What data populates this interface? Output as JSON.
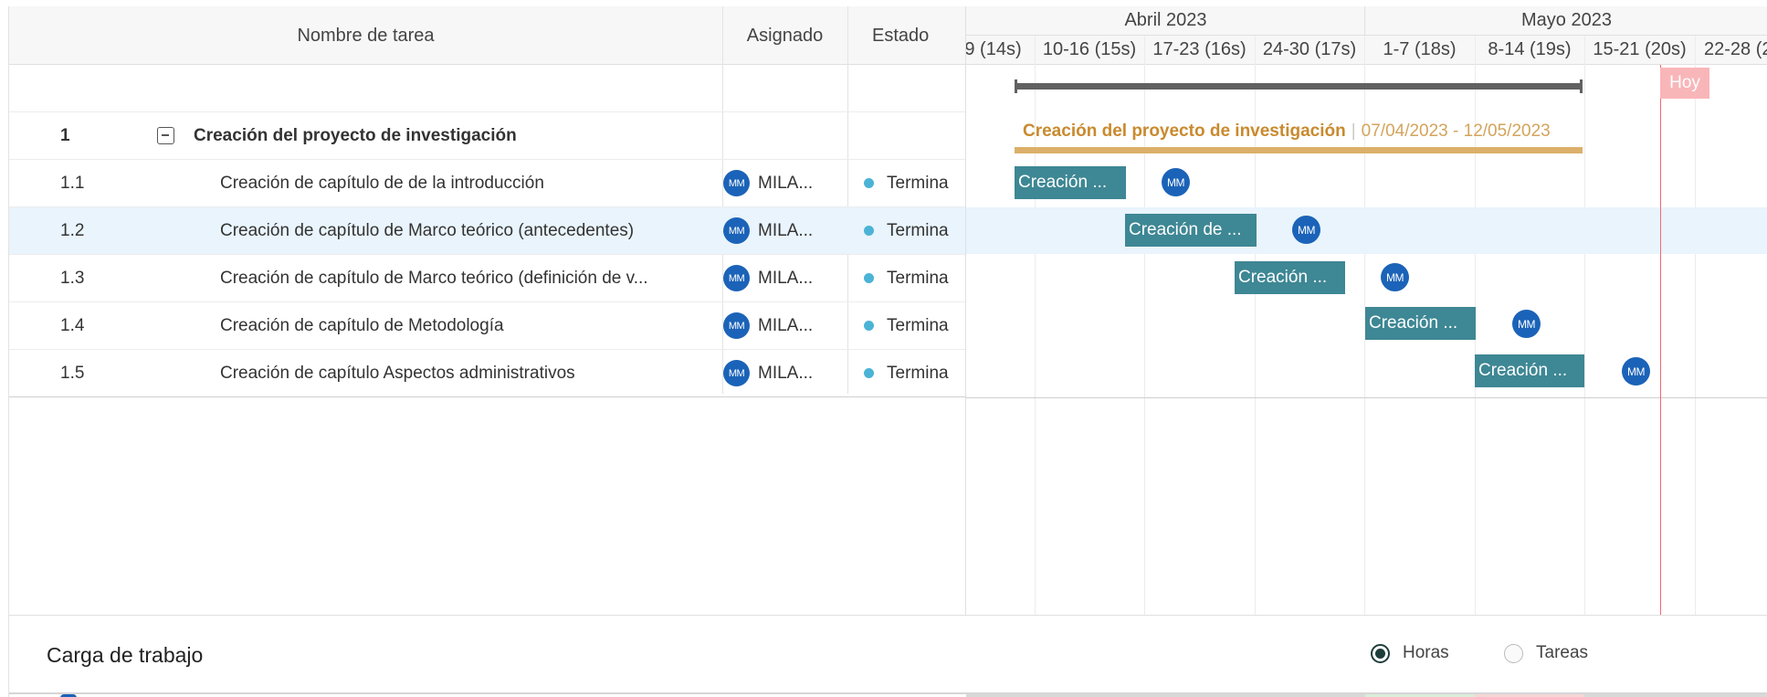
{
  "header": {
    "col_task": "Nombre de tarea",
    "col_assignee": "Asignado",
    "col_status": "Estado"
  },
  "rows": [
    {
      "num": "1",
      "name": "Creación del proyecto de investigación",
      "assignee_initials": "",
      "assignee": "",
      "status": ""
    },
    {
      "num": "1.1",
      "name": "Creación de capítulo de de la introducción",
      "assignee_initials": "MM",
      "assignee": "MILA...",
      "status": "Termina"
    },
    {
      "num": "1.2",
      "name": "Creación de capítulo de Marco teórico (antecedentes)",
      "assignee_initials": "MM",
      "assignee": "MILA...",
      "status": "Termina"
    },
    {
      "num": "1.3",
      "name": "Creación de capítulo de Marco teórico (definición de v...",
      "assignee_initials": "MM",
      "assignee": "MILA...",
      "status": "Termina"
    },
    {
      "num": "1.4",
      "name": "Creación de capítulo de Metodología",
      "assignee_initials": "MM",
      "assignee": "MILA...",
      "status": "Termina"
    },
    {
      "num": "1.5",
      "name": "Creación de capítulo Aspectos administrativos",
      "assignee_initials": "MM",
      "assignee": "MILA...",
      "status": "Termina"
    }
  ],
  "timeline": {
    "months": [
      "Abril 2023",
      "Mayo 2023"
    ],
    "weeks": [
      "9 (14s)",
      "10-16 (15s)",
      "17-23 (16s)",
      "24-30 (17s)",
      "1-7 (18s)",
      "8-14 (19s)",
      "15-21 (20s)",
      "22-28 (2"
    ],
    "today_label": "Hoy",
    "summary_title": "Creación del proyecto de investigación",
    "summary_dates": "07/04/2023 - 12/05/2023",
    "bars": [
      {
        "label": "Creación ...",
        "initials": "MM"
      },
      {
        "label": "Creación de ...",
        "initials": "MM"
      },
      {
        "label": "Creación ...",
        "initials": "MM"
      },
      {
        "label": "Creación ...",
        "initials": "MM"
      },
      {
        "label": "Creación ...",
        "initials": "MM"
      }
    ]
  },
  "workload": {
    "title": "Carga de trabajo",
    "option_hours": "Horas",
    "option_tasks": "Tareas",
    "selected": "Horas"
  },
  "colors": {
    "task_bar": "#3e8794",
    "summary": "#dcb06a",
    "summary_title": "#c98a2e",
    "avatar": "#1b63b8",
    "status_dot": "#4bb3d6",
    "today": "#f06a74",
    "today_badge": "#f9b6b9",
    "selected_row": "#e9f4fc"
  }
}
